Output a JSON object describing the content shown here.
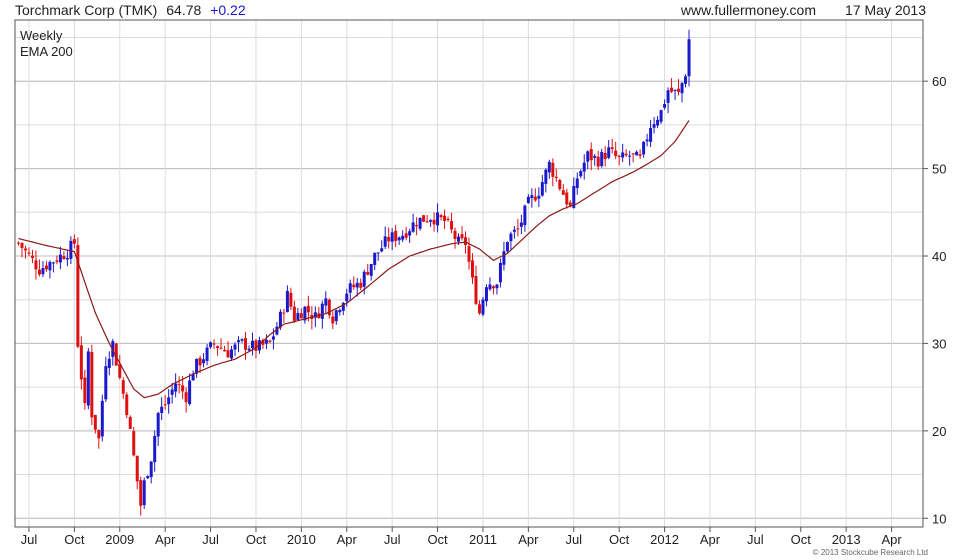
{
  "header": {
    "name": "Torchmark Corp (TMK)",
    "last": "64.78",
    "change": "+0.22",
    "site": "www.fullermoney.com",
    "date": "17 May 2013"
  },
  "copyright": "© 2013 Stockcube Research Ltd",
  "colors": {
    "up": "#1a1acc",
    "down": "#dd1111",
    "ema": "#8b1a1a",
    "grid": "#dcdcdc",
    "frame": "#555555"
  },
  "chart_data": {
    "type": "candlestick",
    "ylim": [
      9,
      67
    ],
    "yticks": [
      10,
      20,
      30,
      40,
      50,
      60
    ],
    "grid": "on",
    "legend": [
      {
        "label": "Weekly",
        "color": "#1a1acc"
      },
      {
        "label": "EMA 200",
        "color": "#8b1a1a"
      }
    ],
    "legend_position": "top-left",
    "x_tick_labels": [
      "Jul",
      "Oct",
      "2009",
      "Apr",
      "Jul",
      "Oct",
      "2010",
      "Apr",
      "Jul",
      "Oct",
      "2011",
      "Apr",
      "Jul",
      "Oct",
      "2012",
      "Apr",
      "Jul",
      "Oct",
      "2013",
      "Apr"
    ],
    "x_ticks_week": [
      3,
      16,
      29,
      42,
      55,
      68,
      81,
      94,
      107,
      120,
      133,
      146,
      159,
      172,
      185,
      198,
      211,
      224,
      237,
      250
    ],
    "x_range_weeks": [
      -1,
      259
    ],
    "weekly_close_keypoints": [
      [
        0,
        41.5
      ],
      [
        6,
        38.5
      ],
      [
        10,
        39.5
      ],
      [
        14,
        40.5
      ],
      [
        16,
        41.5
      ],
      [
        17,
        30
      ],
      [
        19,
        22.5
      ],
      [
        20,
        29
      ],
      [
        21,
        22
      ],
      [
        23,
        19
      ],
      [
        25,
        28
      ],
      [
        27,
        30
      ],
      [
        29,
        26
      ],
      [
        31,
        22.5
      ],
      [
        33,
        17
      ],
      [
        35,
        11.5
      ],
      [
        36,
        14
      ],
      [
        38,
        17
      ],
      [
        40,
        22
      ],
      [
        42,
        23
      ],
      [
        45,
        25.5
      ],
      [
        48,
        24
      ],
      [
        50,
        27
      ],
      [
        53,
        28.5
      ],
      [
        56,
        30
      ],
      [
        60,
        29
      ],
      [
        64,
        30
      ],
      [
        68,
        29.5
      ],
      [
        72,
        30
      ],
      [
        75,
        33
      ],
      [
        77,
        35.5
      ],
      [
        79,
        33
      ],
      [
        82,
        34
      ],
      [
        85,
        33
      ],
      [
        88,
        35
      ],
      [
        90,
        33
      ],
      [
        94,
        36
      ],
      [
        98,
        37
      ],
      [
        102,
        40
      ],
      [
        106,
        42
      ],
      [
        110,
        42.5
      ],
      [
        114,
        44
      ],
      [
        118,
        44.5
      ],
      [
        122,
        44
      ],
      [
        126,
        41.5
      ],
      [
        128,
        41.5
      ],
      [
        130,
        37
      ],
      [
        132,
        33.5
      ],
      [
        134,
        37
      ],
      [
        137,
        37
      ],
      [
        140,
        42
      ],
      [
        143,
        43
      ],
      [
        146,
        46
      ],
      [
        149,
        47.5
      ],
      [
        152,
        50.5
      ],
      [
        155,
        48
      ],
      [
        158,
        45.5
      ],
      [
        160,
        49
      ],
      [
        163,
        51.5
      ],
      [
        166,
        51
      ],
      [
        169,
        52
      ],
      [
        172,
        51
      ],
      [
        175,
        51.5
      ],
      [
        178,
        51
      ],
      [
        181,
        55
      ],
      [
        184,
        56.5
      ],
      [
        186,
        59
      ],
      [
        189,
        58.5
      ],
      [
        191,
        61
      ],
      [
        192,
        64.8
      ]
    ],
    "weekly_close_annotation": "64.78",
    "ema_200_keypoints": [
      [
        0,
        42
      ],
      [
        8,
        41.2
      ],
      [
        16,
        40.5
      ],
      [
        19,
        37
      ],
      [
        22,
        33.5
      ],
      [
        26,
        30
      ],
      [
        30,
        27
      ],
      [
        33,
        24.8
      ],
      [
        36,
        23.8
      ],
      [
        40,
        24.2
      ],
      [
        44,
        25.3
      ],
      [
        50,
        26.5
      ],
      [
        56,
        27.5
      ],
      [
        62,
        28.2
      ],
      [
        68,
        29.5
      ],
      [
        72,
        31
      ],
      [
        76,
        32.2
      ],
      [
        82,
        32.8
      ],
      [
        88,
        33.4
      ],
      [
        94,
        34.6
      ],
      [
        100,
        36.5
      ],
      [
        106,
        38.5
      ],
      [
        112,
        40
      ],
      [
        118,
        40.8
      ],
      [
        124,
        41.4
      ],
      [
        128,
        41.6
      ],
      [
        132,
        40.8
      ],
      [
        136,
        39.5
      ],
      [
        140,
        40.3
      ],
      [
        144,
        41.8
      ],
      [
        148,
        43.3
      ],
      [
        152,
        44.6
      ],
      [
        156,
        45.4
      ],
      [
        160,
        46
      ],
      [
        164,
        47
      ],
      [
        170,
        48.5
      ],
      [
        176,
        49.6
      ],
      [
        180,
        50.5
      ],
      [
        184,
        51.5
      ],
      [
        188,
        53.1
      ],
      [
        192,
        55.5
      ]
    ]
  }
}
